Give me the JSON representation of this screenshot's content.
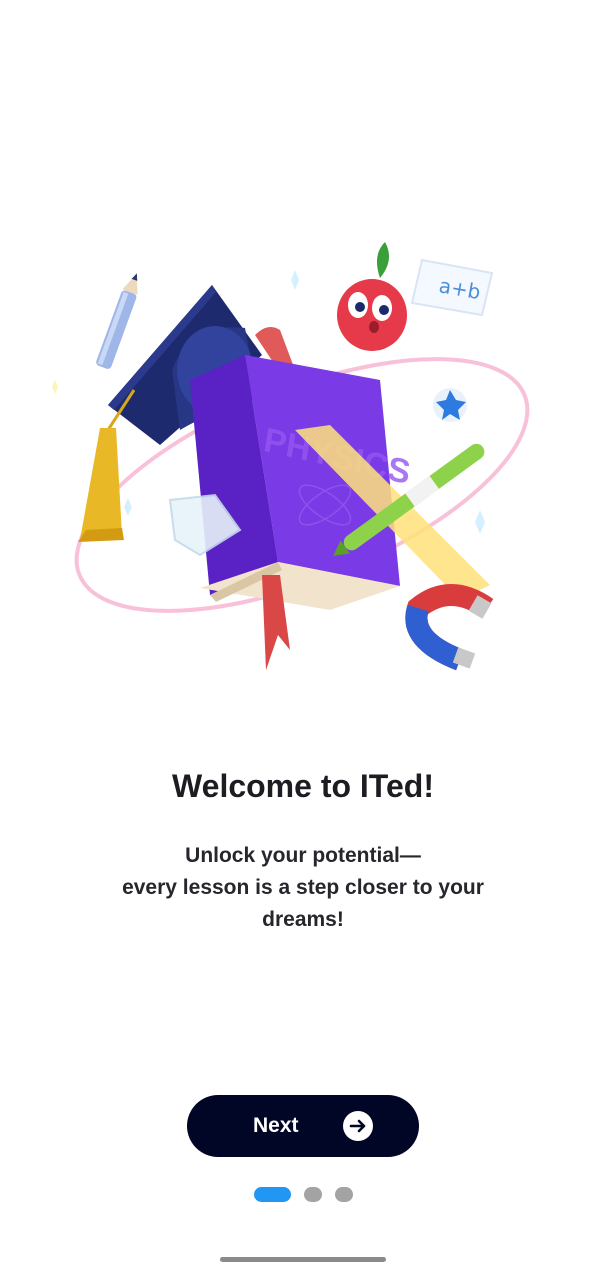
{
  "onboarding": {
    "title": "Welcome to ITed!",
    "subtitle_lines": [
      "Unlock your potential—",
      "every lesson is a step closer to your",
      "dreams!"
    ],
    "illustration": {
      "book_label": "PHYSICS",
      "card_text": "a+b"
    },
    "next_button": {
      "label": "Next",
      "icon": "arrow-right-icon"
    },
    "pagination": {
      "total": 3,
      "active_index": 0
    }
  },
  "colors": {
    "button_background": "#020626",
    "active_dot": "#2196f3",
    "inactive_dot": "#a3a3a3",
    "book": "#6a2fd8"
  }
}
